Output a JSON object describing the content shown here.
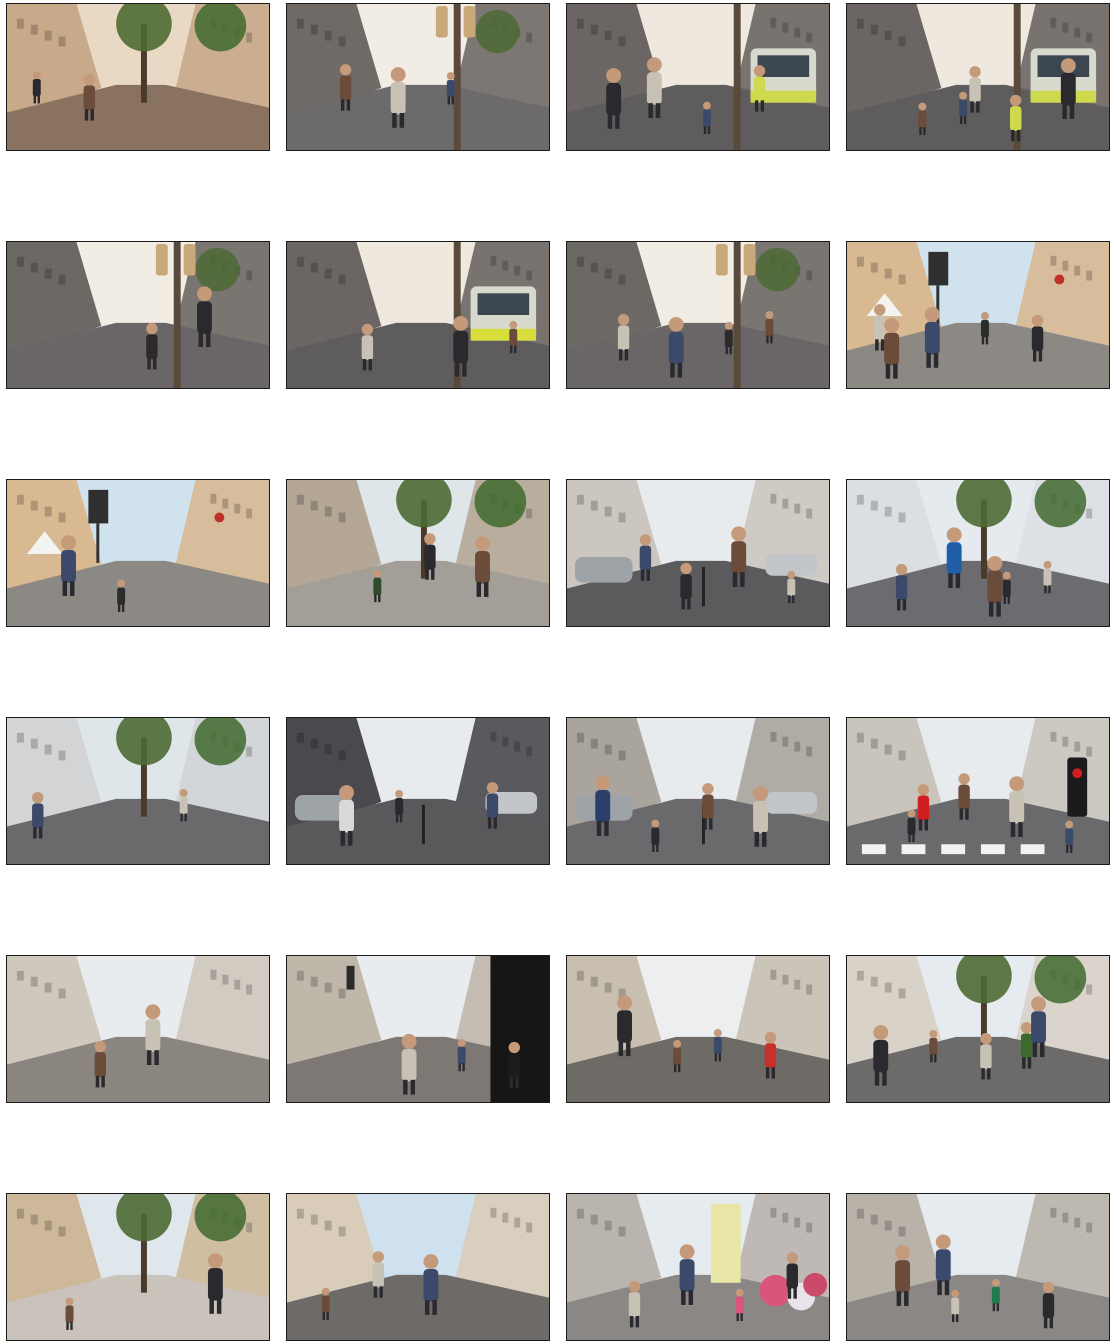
{
  "grid": {
    "rows": 6,
    "cols": 4,
    "frames": [
      {
        "scene": "plaza-bench",
        "sky": "#e9d9c4",
        "ground": "#8a7260",
        "building": "#c8a98a",
        "accent": "#3a2e28",
        "feature": "tree"
      },
      {
        "scene": "street-tram-stop",
        "sky": "#f1ece4",
        "ground": "#6d6a6c",
        "building": "#6f6a66",
        "accent": "#2e2a2a",
        "feature": "pole"
      },
      {
        "scene": "street-tram-arriving",
        "sky": "#efe8de",
        "ground": "#5f5c5e",
        "building": "#6b6663",
        "accent": "#cfd94e",
        "feature": "tram"
      },
      {
        "scene": "street-tram-woman",
        "sky": "#efe8de",
        "ground": "#5f5c5e",
        "building": "#6b6663",
        "accent": "#cfd94e",
        "feature": "tram"
      },
      {
        "scene": "street-pole",
        "sky": "#f1ece4",
        "ground": "#6a6567",
        "building": "#6c6864",
        "accent": "#2e2a2a",
        "feature": "pole"
      },
      {
        "scene": "street-crowd-tram",
        "sky": "#efe8de",
        "ground": "#5f5c5e",
        "building": "#6b6663",
        "accent": "#d8df3a",
        "feature": "tram"
      },
      {
        "scene": "street-crowd",
        "sky": "#f1ece4",
        "ground": "#6a6567",
        "building": "#6c6864",
        "accent": "#2e2a2a",
        "feature": "pole"
      },
      {
        "scene": "square-buildings",
        "sky": "#cfe2ee",
        "ground": "#8c8884",
        "building": "#d8b992",
        "accent": "#2c2c2c",
        "feature": "tent"
      },
      {
        "scene": "square-crowd",
        "sky": "#cfe2ee",
        "ground": "#8c8884",
        "building": "#d8b992",
        "accent": "#2c2c2c",
        "feature": "tent"
      },
      {
        "scene": "sidewalk-railing",
        "sky": "#dfe6ea",
        "ground": "#a39e98",
        "building": "#b5a796",
        "accent": "#2f4a2c",
        "feature": "trees"
      },
      {
        "scene": "side-street-parked",
        "sky": "#e8ebee",
        "ground": "#5b5b5e",
        "building": "#cbc6bf",
        "accent": "#3a3a3a",
        "feature": "car"
      },
      {
        "scene": "corner-crossing",
        "sky": "#e5eaef",
        "ground": "#6c6c70",
        "building": "#dcdfe2",
        "accent": "#1f5fa8",
        "feature": "trees"
      },
      {
        "scene": "street-hedge",
        "sky": "#dfe6ea",
        "ground": "#6a6a6d",
        "building": "#d2d4d6",
        "accent": "#2f5a2a",
        "feature": "trees"
      },
      {
        "scene": "shop-window-road",
        "sky": "#e8ebee",
        "ground": "#59595c",
        "building": "#4a4a4e",
        "accent": "#d9d9d9",
        "feature": "car"
      },
      {
        "scene": "sidewalk-walker",
        "sky": "#e8ebee",
        "ground": "#6a6a6d",
        "building": "#a9a49c",
        "accent": "#2b3f6a",
        "feature": "car"
      },
      {
        "scene": "crosswalk-signal",
        "sky": "#e8ebee",
        "ground": "#6a6a6d",
        "building": "#c9c4bc",
        "accent": "#d11f1f",
        "feature": "crosswalk"
      },
      {
        "scene": "tram-track-walkers",
        "sky": "#e9ecef",
        "ground": "#8b8580",
        "building": "#cfc8bd",
        "accent": "#222222",
        "feature": "walkers"
      },
      {
        "scene": "shop-sign-boy",
        "sky": "#e9ecef",
        "ground": "#7d7873",
        "building": "#c0b7ab",
        "accent": "#1c1c1c",
        "feature": "sign"
      },
      {
        "scene": "street-red-shirt",
        "sky": "#eceef0",
        "ground": "#6e6a66",
        "building": "#c8bfb1",
        "accent": "#c8302a",
        "feature": "walkers"
      },
      {
        "scene": "avenue-trees",
        "sky": "#e6ebef",
        "ground": "#6d6b6a",
        "building": "#d8d2c8",
        "accent": "#3c6a2e",
        "feature": "trees"
      },
      {
        "scene": "plaza-cyclist",
        "sky": "#dfe7ec",
        "ground": "#c9c3bb",
        "building": "#cdb99a",
        "accent": "#b8383a",
        "feature": "trees"
      },
      {
        "scene": "narrow-street",
        "sky": "#cfe1ee",
        "ground": "#6d6a68",
        "building": "#d9cdb9",
        "accent": "#2f3a46",
        "feature": "walkers"
      },
      {
        "scene": "flower-shop",
        "sky": "#e6ebef",
        "ground": "#8a8784",
        "building": "#b9b4ae",
        "accent": "#d9557a",
        "feature": "flowers"
      },
      {
        "scene": "shop-corner",
        "sky": "#e6ebef",
        "ground": "#8a8784",
        "building": "#b8b2a9",
        "accent": "#1f7a4e",
        "feature": "walkers"
      }
    ]
  }
}
